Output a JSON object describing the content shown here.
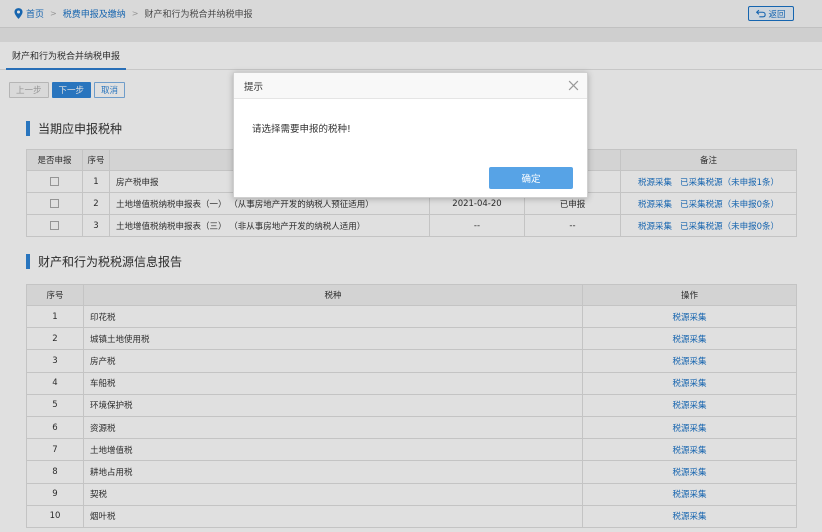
{
  "breadcrumb": {
    "home": "首页",
    "level1": "税费申报及缴纳",
    "separator": ">",
    "current": "财产和行为税合并纳税申报",
    "back_label": "返回"
  },
  "tab": {
    "label": "财产和行为税合并纳税申报"
  },
  "toolbar": {
    "prev": "上一步",
    "next": "下一步",
    "cancel": "取消"
  },
  "section1": {
    "title": "当期应申报税种",
    "headers": [
      "是否申报",
      "序号",
      "",
      "",
      "",
      "备注"
    ],
    "rows": [
      {
        "num": "1",
        "name": "房产税申报",
        "date": "",
        "status": "",
        "link1": "税源采集",
        "link2": "已采集税源（未申报1条）"
      },
      {
        "num": "2",
        "name": "土地增值税纳税申报表（一） （从事房地产开发的纳税人预征适用）",
        "date": "2021-04-20",
        "status": "已申报",
        "link1": "税源采集",
        "link2": "已采集税源（未申报0条）"
      },
      {
        "num": "3",
        "name": "土地增值税纳税申报表（三） （非从事房地产开发的纳税人适用）",
        "date": "--",
        "status": "--",
        "link1": "税源采集",
        "link2": "已采集税源（未申报0条）"
      }
    ]
  },
  "section2": {
    "title": "财产和行为税税源信息报告",
    "headers": [
      "序号",
      "税种",
      "操作"
    ],
    "rows": [
      {
        "num": "1",
        "name": "印花税",
        "action": "税源采集"
      },
      {
        "num": "2",
        "name": "城镇土地使用税",
        "action": "税源采集"
      },
      {
        "num": "3",
        "name": "房产税",
        "action": "税源采集"
      },
      {
        "num": "4",
        "name": "车船税",
        "action": "税源采集"
      },
      {
        "num": "5",
        "name": "环境保护税",
        "action": "税源采集"
      },
      {
        "num": "6",
        "name": "资源税",
        "action": "税源采集"
      },
      {
        "num": "7",
        "name": "土地增值税",
        "action": "税源采集"
      },
      {
        "num": "8",
        "name": "耕地占用税",
        "action": "税源采集"
      },
      {
        "num": "9",
        "name": "契税",
        "action": "税源采集"
      },
      {
        "num": "10",
        "name": "烟叶税",
        "action": "税源采集"
      }
    ]
  },
  "dialog": {
    "title": "提示",
    "message": "请选择需要申报的税种!",
    "ok": "确定"
  },
  "colors": {
    "accent": "#2f86d9",
    "link": "#1a73c8"
  }
}
